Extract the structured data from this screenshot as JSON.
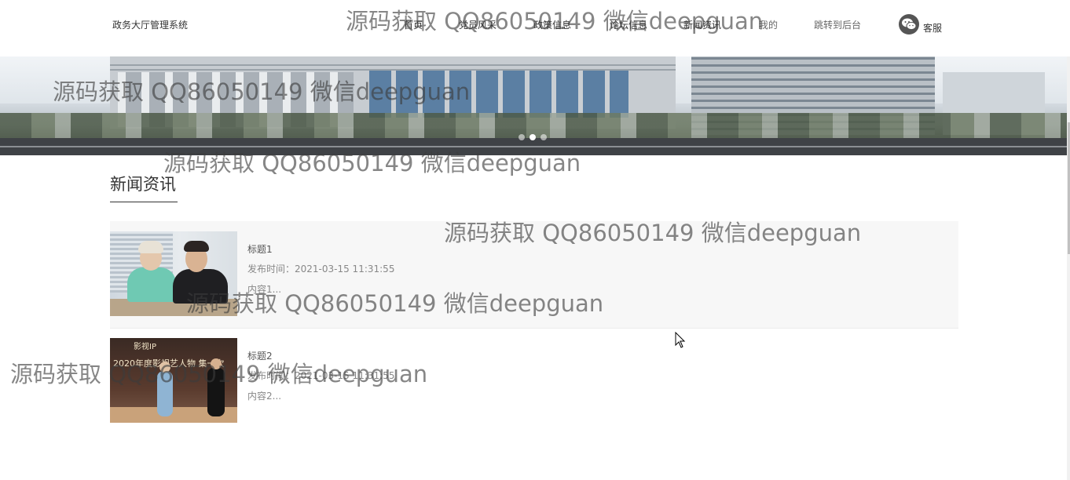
{
  "header": {
    "site_title": "政务大厅管理系统",
    "nav": [
      {
        "label": "首页"
      },
      {
        "label": "党员风采"
      },
      {
        "label": "政策信息"
      },
      {
        "label": "论坛信息"
      },
      {
        "label": "新闻资讯"
      },
      {
        "label": "我的"
      },
      {
        "label": "跳转到后台"
      }
    ],
    "service_label": "客服",
    "service_icon": "wechat-icon"
  },
  "banner": {
    "slides_count": 3,
    "active_slide": 2
  },
  "section": {
    "title": "新闻资讯"
  },
  "news": [
    {
      "title": "标题1",
      "time": "发布时间：2021-03-15 11:31:55",
      "content": "内容1..."
    },
    {
      "title": "标题2",
      "time": "发布时间：2021-03-15 11:31:55",
      "content": "内容2..."
    }
  ],
  "thumb2_text": {
    "logo": "影视IP",
    "headline": "2020年度影视艺人物 集一次"
  },
  "watermark": {
    "text": "源码获取 QQ86050149 微信deepguan"
  },
  "colors": {
    "text": "#333333",
    "muted": "#888888",
    "highlight_row": "#f7f7f7"
  }
}
